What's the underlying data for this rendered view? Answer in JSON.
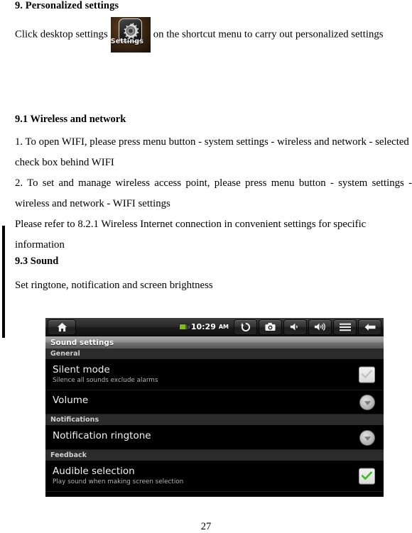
{
  "document": {
    "heading_1": "9. Personalized settings",
    "para_1_before": "Click desktop settings",
    "para_1_after": "on the shortcut menu to carry out personalized settings",
    "settings_icon_label": "Settings",
    "heading_2": "9.1 Wireless and network",
    "para_2": "1. To open WIFI, please press menu button - system settings - wireless and network - selected check box behind WIFI",
    "para_3": "2. To set and manage wireless access point, please press menu button - system settings - wireless and network - WIFI settings",
    "para_4": "Please refer to 8.2.1 Wireless Internet connection in convenient settings for specific information",
    "heading_3": "9.3 Sound",
    "para_5": "Set ringtone, notification and screen brightness",
    "page_number": "27"
  },
  "screenshot": {
    "statusbar": {
      "home_icon": "home-icon",
      "battery_icon": "battery-icon",
      "time": "10:29",
      "ampm": "AM",
      "buttons": [
        {
          "name": "refresh-button",
          "icon": "refresh-icon"
        },
        {
          "name": "camera-button",
          "icon": "camera-icon"
        },
        {
          "name": "volume-down-button",
          "icon": "volume-down-icon"
        },
        {
          "name": "volume-up-button",
          "icon": "volume-up-icon"
        },
        {
          "name": "menu-button",
          "icon": "menu-icon"
        },
        {
          "name": "back-button",
          "icon": "back-arrow-icon"
        }
      ]
    },
    "title": "Sound settings",
    "sections": [
      {
        "header": "General",
        "rows": [
          {
            "title": "Silent mode",
            "subtitle": "Silence all sounds exclude alarms",
            "widget": "checkbox",
            "checked": false
          },
          {
            "title": "Volume",
            "subtitle": "",
            "widget": "chevron",
            "checked": false
          }
        ]
      },
      {
        "header": "Notifications",
        "rows": [
          {
            "title": "Notification ringtone",
            "subtitle": "",
            "widget": "chevron",
            "checked": false
          }
        ]
      },
      {
        "header": "Feedback",
        "rows": [
          {
            "title": "Audible selection",
            "subtitle": "Play sound when making screen selection",
            "widget": "checkbox",
            "checked": true
          }
        ]
      }
    ],
    "colors": {
      "checked_green": "#35c21b",
      "battery_green": "#7cc00b",
      "row_background": "#000000",
      "section_header_background": "#2b2b2b"
    }
  }
}
